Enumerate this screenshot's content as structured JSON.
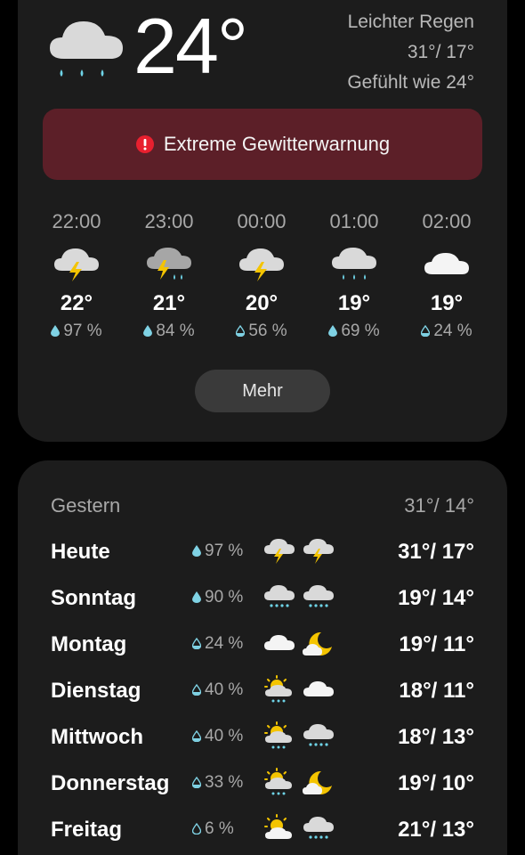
{
  "current": {
    "temperature": "24°",
    "condition": "Leichter Regen",
    "high_low": "31°/ 17°",
    "feels_like": "Gefühlt wie 24°",
    "icon": "light-rain-icon"
  },
  "alert": {
    "icon": "alert-circle-icon",
    "text": "Extreme Gewitterwarnung",
    "color": "#5c1f28"
  },
  "hourly": [
    {
      "time": "22:00",
      "icon": "thunderstorm-icon",
      "temp": "22°",
      "precip": "97 %"
    },
    {
      "time": "23:00",
      "icon": "thunderstorm-rain-icon",
      "temp": "21°",
      "precip": "84 %"
    },
    {
      "time": "00:00",
      "icon": "thunderstorm-icon",
      "temp": "20°",
      "precip": "56 %"
    },
    {
      "time": "01:00",
      "icon": "rain-icon",
      "temp": "19°",
      "precip": "69 %"
    },
    {
      "time": "02:00",
      "icon": "cloud-icon",
      "temp": "19°",
      "precip": "24 %"
    }
  ],
  "more_button": "Mehr",
  "yesterday": {
    "label": "Gestern",
    "temps": "31°/ 14°"
  },
  "daily": [
    {
      "day": "Heute",
      "precip": "97 %",
      "icon_day": "thunderstorm-icon",
      "icon_night": "thunderstorm-icon",
      "temps": "31°/ 17°"
    },
    {
      "day": "Sonntag",
      "precip": "90 %",
      "icon_day": "rain-icon",
      "icon_night": "rain-icon",
      "temps": "19°/ 14°"
    },
    {
      "day": "Montag",
      "precip": "24 %",
      "icon_day": "cloud-icon",
      "icon_night": "moon-cloud-icon",
      "temps": "19°/ 11°"
    },
    {
      "day": "Dienstag",
      "precip": "40 %",
      "icon_day": "sun-cloud-rain-icon",
      "icon_night": "cloud-icon",
      "temps": "18°/ 11°"
    },
    {
      "day": "Mittwoch",
      "precip": "40 %",
      "icon_day": "sun-cloud-rain-icon",
      "icon_night": "rain-icon",
      "temps": "18°/ 13°"
    },
    {
      "day": "Donnerstag",
      "precip": "33 %",
      "icon_day": "sun-cloud-rain-icon",
      "icon_night": "moon-cloud-icon",
      "temps": "19°/ 10°"
    },
    {
      "day": "Freitag",
      "precip": "6 %",
      "icon_day": "sun-cloud-icon",
      "icon_night": "rain-icon",
      "temps": "21°/ 13°"
    }
  ]
}
